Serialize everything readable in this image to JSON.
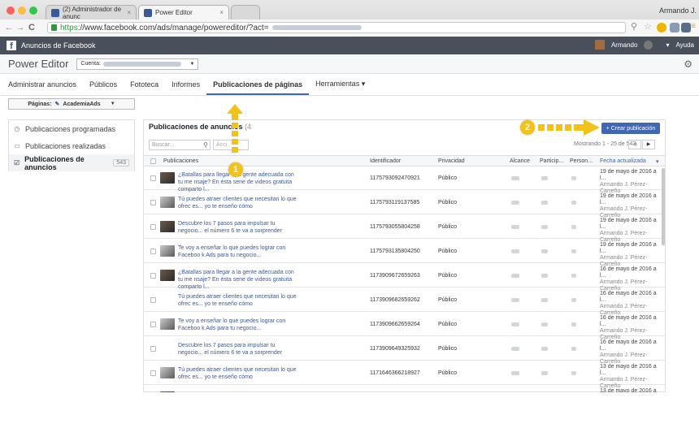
{
  "browser": {
    "tabs": [
      {
        "title": "(2) Administrador de anunc"
      },
      {
        "title": "Power Editor"
      }
    ],
    "profile": "Armando J.",
    "url_https": "https",
    "url_rest": "://www.facebook.com/ads/manage/powereditor/?act="
  },
  "fb": {
    "title": "Anuncios de Facebook",
    "user": "Armando",
    "help": "Ayuda"
  },
  "pe": {
    "title": "Power Editor",
    "account_label": "Cuenta:"
  },
  "nav_tabs": [
    {
      "label": "Administrar anuncios"
    },
    {
      "label": "Públicos"
    },
    {
      "label": "Fototeca"
    },
    {
      "label": "Informes"
    },
    {
      "label": "Publicaciones de páginas"
    },
    {
      "label": "Herramientas ▾"
    }
  ],
  "pages_selector": {
    "label": "Páginas:",
    "value": "AcademiaAds"
  },
  "sidebar": {
    "items": [
      {
        "label": "Publicaciones programadas",
        "icon": "clock-icon"
      },
      {
        "label": "Publicaciones realizadas",
        "icon": "calendar-icon"
      },
      {
        "label": "Publicaciones de anuncios",
        "icon": "edit-icon",
        "count": "543"
      }
    ]
  },
  "main": {
    "title": "Publicaciones de anuncios",
    "title_count": "(4",
    "create_button": "+ Crear publicación",
    "search_placeholder": "Buscar...",
    "actions_label": "Acci",
    "showing": "Mostrando 1 - 25 de 543"
  },
  "table": {
    "headers": [
      "Publicaciones",
      "Identificador",
      "Privacidad",
      "Alcance",
      "Particip...",
      "Person...",
      "Fecha actualizada"
    ],
    "rows": [
      {
        "text": "¿Batallas para llegar a la gente adecuada con tu me nsaje? En ésta serie de videos gratuita comparto l...",
        "id": "1175793092470921",
        "privacy": "Público",
        "date": "19 de mayo de 2016 a l...",
        "author": "Armando J. Pérez-Carreño"
      },
      {
        "text": "Tú puedes atraer clientes que necesitan lo que ofrec es... yo te enseño cómo",
        "id": "1175793119137585",
        "privacy": "Público",
        "date": "19 de mayo de 2016 a l...",
        "author": "Armando J. Pérez-Carreño"
      },
      {
        "text": "Descubre los 7 pasos para impulsar tu negocio... el número 6 te va a sorprender",
        "id": "1175793055804258",
        "privacy": "Público",
        "date": "19 de mayo de 2016 a l...",
        "author": "Armando J. Pérez-Carreño"
      },
      {
        "text": "Te voy a enseñar lo que puedes lograr con Faceboo k Ads para tu negocio...",
        "id": "1175793135804250",
        "privacy": "Público",
        "date": "19 de mayo de 2016 a l...",
        "author": "Armando J. Pérez-Carreño"
      },
      {
        "text": "¿Batallas para llegar a la gente adecuada con tu me nsaje? En ésta serie de videos gratuita comparto l...",
        "id": "1173909672659263",
        "privacy": "Público",
        "date": "16 de mayo de 2016 a l...",
        "author": "Armando J. Pérez-Carreño"
      },
      {
        "text": "Tú puedes atraer clientes que necesitan lo que ofrec es... yo te enseño cómo",
        "id": "1173909682659262",
        "privacy": "Público",
        "date": "16 de mayo de 2016 a l...",
        "author": "Armando J. Pérez-Carreño"
      },
      {
        "text": "Te voy a enseñar lo que puedes lograr con Faceboo k Ads para tu negocio...",
        "id": "1173909662659264",
        "privacy": "Público",
        "date": "16 de mayo de 2016 a l...",
        "author": "Armando J. Pérez-Carreño"
      },
      {
        "text": "Descubre los 7 pasos para impulsar tu negocio... el número 6 te va a sorprender",
        "id": "1173909649325932",
        "privacy": "Público",
        "date": "16 de mayo de 2016 a l...",
        "author": "Armando J. Pérez-Carreño"
      },
      {
        "text": "Tú puedes atraer clientes que necesitan lo que ofrec es... yo te enseño cómo",
        "id": "1171646366218927",
        "privacy": "Público",
        "date": "13 de mayo de 2016 a l...",
        "author": "Armando J. Pérez-Carreño"
      },
      {
        "text": "",
        "id": "",
        "privacy": "",
        "date": "13 de mayo de 2016 a l...",
        "author": ""
      }
    ]
  },
  "annotations": [
    {
      "number": "1"
    },
    {
      "number": "2"
    }
  ],
  "colors": {
    "fb_blue": "#4267b2",
    "annotation_yellow": "#f2c11a"
  }
}
